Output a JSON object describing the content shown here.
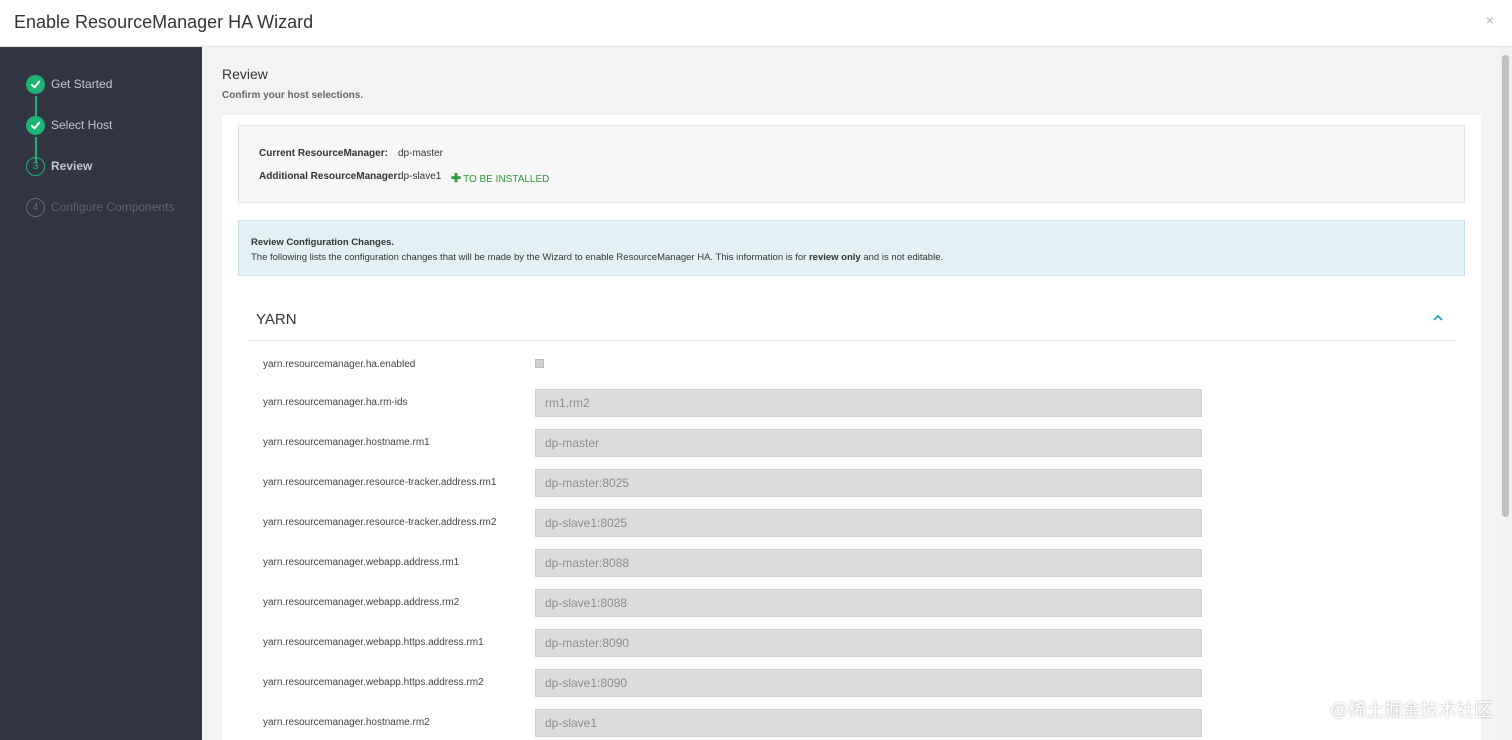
{
  "modal": {
    "title": "Enable ResourceManager HA Wizard",
    "close_label": "×"
  },
  "sidebar": {
    "steps": [
      {
        "number": "1",
        "label": "Get Started",
        "state": "done"
      },
      {
        "number": "2",
        "label": "Select Host",
        "state": "done"
      },
      {
        "number": "3",
        "label": "Review",
        "state": "current"
      },
      {
        "number": "4",
        "label": "Configure Components",
        "state": "pending"
      }
    ]
  },
  "main": {
    "title": "Review",
    "subtitle": "Confirm your host selections.",
    "hosts": {
      "current_label": "Current ResourceManager:",
      "current_value": "dp-master",
      "additional_label": "Additional ResourceManager:",
      "additional_value": "dp-slave1",
      "install_badge": "TO BE INSTALLED"
    },
    "info": {
      "title": "Review Configuration Changes.",
      "text_before": "The following lists the configuration changes that will be made by the Wizard to enable ResourceManager HA. This information is for ",
      "text_bold": "review only",
      "text_after": " and is not editable."
    },
    "section": {
      "title": "YARN"
    },
    "configs": [
      {
        "name": "yarn.resourcemanager.ha.enabled",
        "value": ""
      },
      {
        "name": "yarn.resourcemanager.ha.rm-ids",
        "value": "rm1,rm2"
      },
      {
        "name": "yarn.resourcemanager.hostname.rm1",
        "value": "dp-master"
      },
      {
        "name": "yarn.resourcemanager.resource-tracker.address.rm1",
        "value": "dp-master:8025"
      },
      {
        "name": "yarn.resourcemanager.resource-tracker.address.rm2",
        "value": "dp-slave1:8025"
      },
      {
        "name": "yarn.resourcemanager.webapp.address.rm1",
        "value": "dp-master:8088"
      },
      {
        "name": "yarn.resourcemanager.webapp.address.rm2",
        "value": "dp-slave1:8088"
      },
      {
        "name": "yarn.resourcemanager.webapp.https.address.rm1",
        "value": "dp-master:8090"
      },
      {
        "name": "yarn.resourcemanager.webapp.https.address.rm2",
        "value": "dp-slave1:8090"
      },
      {
        "name": "yarn.resourcemanager.hostname.rm2",
        "value": "dp-slave1"
      }
    ]
  },
  "watermark": "@稀土掘金技术社区",
  "colors": {
    "accent": "#1eb475",
    "sidebar_bg": "#323544",
    "install_green": "#2a9a3a"
  }
}
